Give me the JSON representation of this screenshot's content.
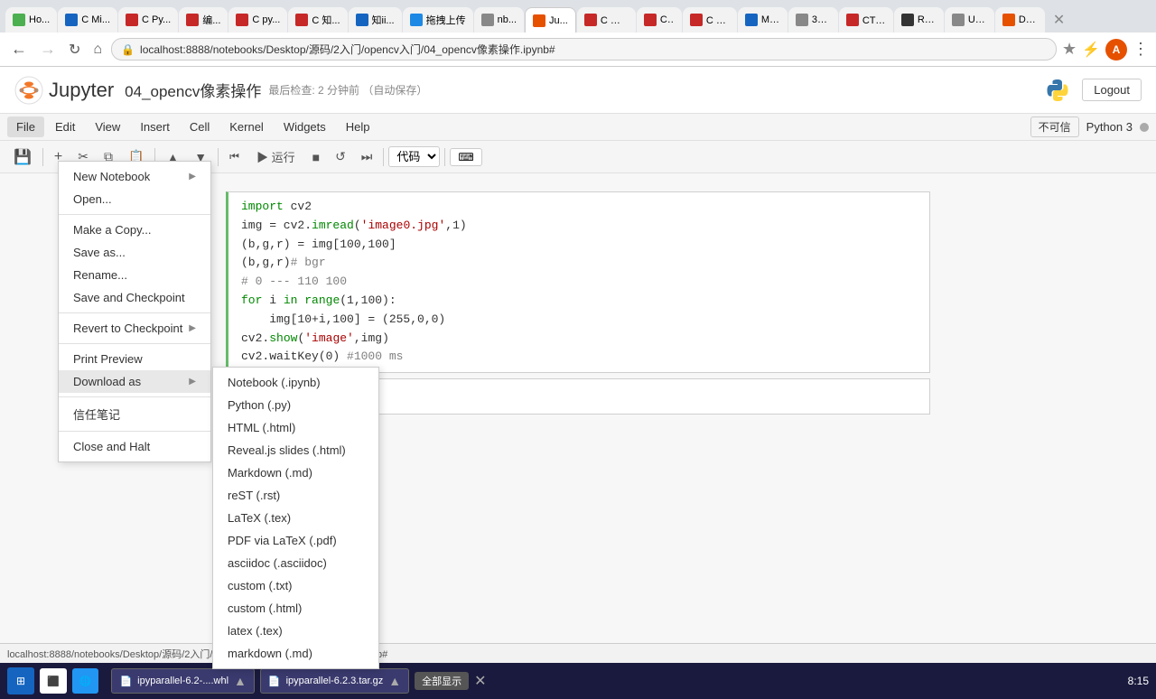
{
  "browser": {
    "tabs": [
      {
        "label": "Ho...",
        "color": "#4caf50",
        "active": false
      },
      {
        "label": "C Mi...",
        "color": "#1565c0",
        "active": false
      },
      {
        "label": "C Py...",
        "color": "#c62828",
        "active": false
      },
      {
        "label": "编...",
        "color": "#c62828",
        "active": false
      },
      {
        "label": "C py...",
        "color": "#c62828",
        "active": false
      },
      {
        "label": "C 知...",
        "color": "#c62828",
        "active": false
      },
      {
        "label": "知ii...",
        "color": "#1565c0",
        "active": false
      },
      {
        "label": "拖拽上传",
        "color": "#1565c0",
        "active": false
      },
      {
        "label": "nb...",
        "color": "#888",
        "active": false
      },
      {
        "label": "Ju...",
        "color": "#e65100",
        "active": true
      },
      {
        "label": "C 如...",
        "color": "#c62828",
        "active": false
      },
      {
        "label": "C ...",
        "color": "#c62828",
        "active": false
      },
      {
        "label": "C 论...",
        "color": "#c62828",
        "active": false
      },
      {
        "label": "M ...",
        "color": "#1565c0",
        "active": false
      },
      {
        "label": "36...",
        "color": "#888",
        "active": false
      },
      {
        "label": "CT 差",
        "color": "#c62828",
        "active": false
      },
      {
        "label": "Re...",
        "color": "#333",
        "active": false
      },
      {
        "label": "Us...",
        "color": "#888",
        "active": false
      },
      {
        "label": "De...",
        "color": "#e65100",
        "active": false
      }
    ],
    "address": "localhost:8888/notebooks/Desktop/源码/2入门/opencv入门/04_opencv像素操作.ipynb#",
    "status_url": "localhost:8888/notebooks/Desktop/源码/2入门/opencv入门/04_opencv像素操作.ipynb#"
  },
  "jupyter": {
    "logo_text": "Jupyter",
    "title": "04_opencv像素操作",
    "save_info": "最后检查: 2 分钟前   （自动保存）",
    "logout_label": "Logout",
    "menu": {
      "items": [
        "File",
        "Edit",
        "View",
        "Insert",
        "Cell",
        "Kernel",
        "Widgets",
        "Help"
      ]
    },
    "toolbar": {
      "cell_type": "代码",
      "trust": "不可信",
      "kernel": "Python 3"
    }
  },
  "file_menu": {
    "items": [
      {
        "label": "New Notebook",
        "has_submenu": true
      },
      {
        "label": "Open...",
        "has_submenu": false
      },
      {
        "label": null
      },
      {
        "label": "Make a Copy...",
        "has_submenu": false
      },
      {
        "label": "Save as...",
        "has_submenu": false
      },
      {
        "label": "Rename...",
        "has_submenu": false
      },
      {
        "label": "Save and Checkpoint",
        "has_submenu": false
      },
      {
        "label": null
      },
      {
        "label": "Revert to Checkpoint",
        "has_submenu": true
      },
      {
        "label": null
      },
      {
        "label": "Print Preview",
        "has_submenu": false
      },
      {
        "label": "Download as",
        "has_submenu": true
      },
      {
        "label": null
      },
      {
        "label": "信任笔记",
        "has_submenu": false
      },
      {
        "label": null
      },
      {
        "label": "Close and Halt",
        "has_submenu": false
      }
    ]
  },
  "download_submenu": {
    "items": [
      "Notebook (.ipynb)",
      "Python (.py)",
      "HTML (.html)",
      "Reveal.js slides (.html)",
      "Markdown (.md)",
      "reST (.rst)",
      "LaTeX (.tex)",
      "PDF via LaTeX (.pdf)",
      "asciidoc (.asciidoc)",
      "custom (.txt)",
      "custom (.html)",
      "latex (.tex)",
      "markdown (.md)"
    ]
  },
  "code_lines": [
    "import cv2",
    "img = cv2.imread('image0.jpg',1)",
    "(b,g,r) = img[100,100]",
    "(b,g,r)# bgr",
    "# 0 --- 110 100",
    "for i in range(1,100):",
    "    img[10+i,100] = (255,0,0)",
    "cv2.show('image',img)",
    "cv2.waitKey(0)  #1000 ms"
  ],
  "taskbar": {
    "downloads": [
      {
        "label": "ipyparallel-6.2-....whl",
        "has_arrow": true
      },
      {
        "label": "ipyparallel-6.2.3.tar.gz",
        "has_arrow": true
      }
    ],
    "show_all": "全部显示",
    "time": "8:15"
  }
}
